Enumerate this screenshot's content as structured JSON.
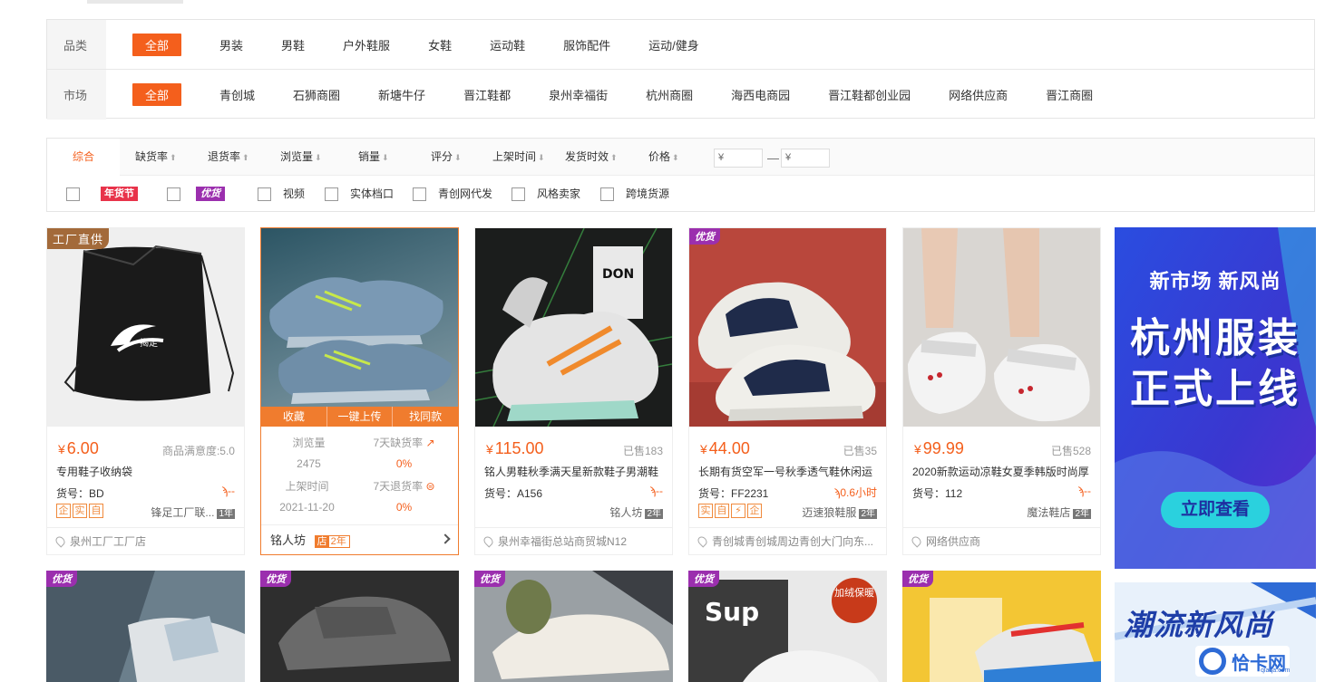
{
  "filters": {
    "category": {
      "label": "品类",
      "items": [
        "全部",
        "男装",
        "男鞋",
        "户外鞋服",
        "女鞋",
        "运动鞋",
        "服饰配件",
        "运动/健身"
      ]
    },
    "market": {
      "label": "市场",
      "items": [
        "全部",
        "青创城",
        "石狮商圈",
        "新塘牛仔",
        "晋江鞋都",
        "泉州幸福街",
        "杭州商圈",
        "海西电商园",
        "晋江鞋都创业园",
        "网络供应商",
        "晋江商圈"
      ]
    }
  },
  "sort": {
    "items": [
      "综合",
      "缺货率",
      "退货率",
      "浏览量",
      "销量",
      "评分",
      "上架时间",
      "发货时效",
      "价格"
    ],
    "price_min_placeholder": "¥",
    "price_max_placeholder": "¥",
    "price_dash": "—"
  },
  "checks": {
    "tag1": "年货节",
    "tag2": "优货",
    "items": [
      "视频",
      "实体档口",
      "青创网代发",
      "风格卖家",
      "跨境货源"
    ]
  },
  "cards": [
    {
      "badge": "工厂直供",
      "price": "6.00",
      "sold": "商品满意度:5.0",
      "title": "专用鞋子收纳袋",
      "code": "货号：BD",
      "speed": "--",
      "icons": [
        "企",
        "实",
        "自"
      ],
      "shop": "锋足工厂联...",
      "years": "1年",
      "location": "泉州工厂工厂店"
    },
    {
      "hover_actions": [
        "收藏",
        "一键上传",
        "找同款"
      ],
      "stat_views_label": "浏览量",
      "stat_views": "2475",
      "stat_oos_label": "7天缺货率",
      "stat_oos": "0%",
      "stat_date_label": "上架时间",
      "stat_date": "2021-11-20",
      "stat_return_label": "7天退货率",
      "stat_return": "0%",
      "shop": "铭人坊",
      "shop_tag": "店",
      "shop_years": "2年"
    },
    {
      "price": "115.00",
      "sold": "已售183",
      "title": "铭人男鞋秋季满天星新款鞋子男潮鞋",
      "code": "货号：A156",
      "speed": "--",
      "shop": "铭人坊",
      "years": "2年",
      "location": "泉州幸福街总站商贸城N12"
    },
    {
      "badge": "优货",
      "price": "44.00",
      "sold": "已售35",
      "title": "长期有货空军一号秋季透气鞋休闲运",
      "code": "货号：FF2231",
      "speed": "0.6小时",
      "icons": [
        "实",
        "自",
        "⚡",
        "企"
      ],
      "shop": "迈速狼鞋服",
      "years": "2年",
      "location": "青创城青创城周边青创大门向东..."
    },
    {
      "price": "99.99",
      "sold": "已售528",
      "title": "2020新款运动凉鞋女夏季韩版时尚厚",
      "code": "货号：112",
      "speed": "--",
      "shop": "魔法鞋店",
      "years": "2年",
      "location": "网络供应商"
    }
  ],
  "row2_badges": [
    "优货",
    "优货",
    "优货",
    "优货",
    "优货"
  ],
  "row2_extra": "加绒保暖",
  "ad": {
    "line1": "新市场 新风尚",
    "line2a": "杭州服装",
    "line2b": "正式上线",
    "button": "立即查看"
  },
  "ad2": {
    "text": "潮流新风尚"
  },
  "watermark": {
    "text": "恰卡网",
    "sub": "qiaqa.com"
  }
}
